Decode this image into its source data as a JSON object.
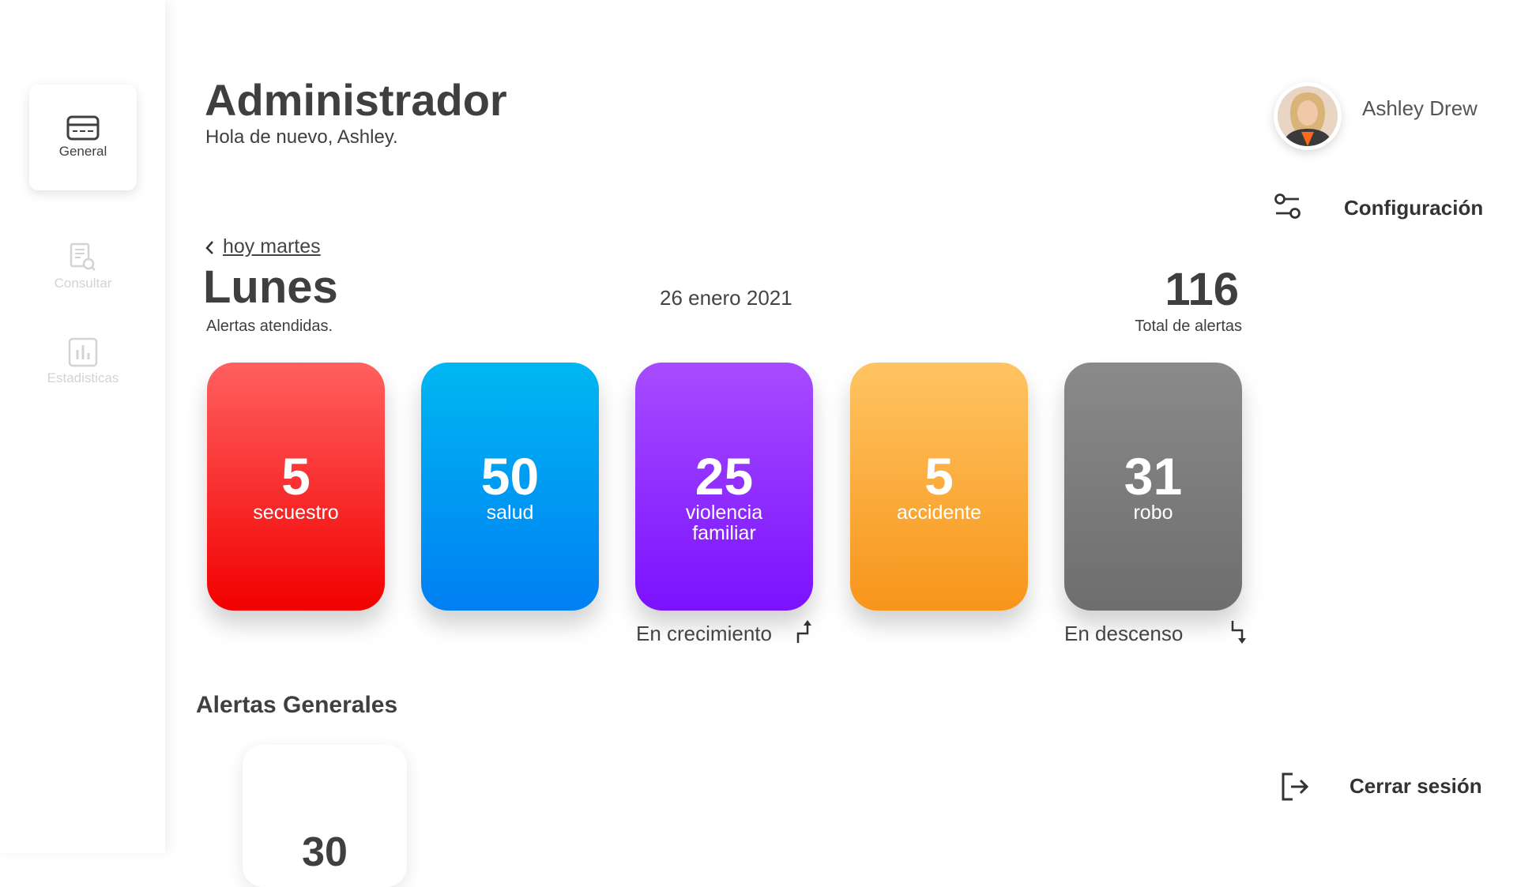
{
  "sidebar": {
    "items": [
      {
        "label": "General",
        "icon": "card-icon",
        "active": true
      },
      {
        "label": "Consultar",
        "icon": "document-search-icon",
        "active": false
      },
      {
        "label": "Estadisticas",
        "icon": "bar-chart-icon",
        "active": false
      }
    ]
  },
  "header": {
    "title": "Administrador",
    "greeting": "Hola de nuevo, Ashley."
  },
  "user": {
    "name": "Ashley Drew",
    "config_label": "Configuración",
    "logout_label": "Cerrar sesión"
  },
  "summary": {
    "back_label": "hoy martes",
    "day": "Lunes",
    "day_caption": "Alertas atendidas.",
    "date": "26 enero 2021",
    "total": "116",
    "total_caption": "Total de alertas"
  },
  "cards": [
    {
      "value": "5",
      "label": "secuestro",
      "color": "#f20000"
    },
    {
      "value": "50",
      "label": "salud",
      "color": "#007ff3"
    },
    {
      "value": "25",
      "label": "violencia familiar",
      "color": "#7b12ff"
    },
    {
      "value": "5",
      "label": "accidente",
      "color": "#f7951a"
    },
    {
      "value": "31",
      "label": "robo",
      "color": "#6e6e6e"
    }
  ],
  "trends": {
    "up_label": "En crecimiento",
    "down_label": "En descenso"
  },
  "general": {
    "title": "Alertas Generales",
    "value": "30"
  }
}
